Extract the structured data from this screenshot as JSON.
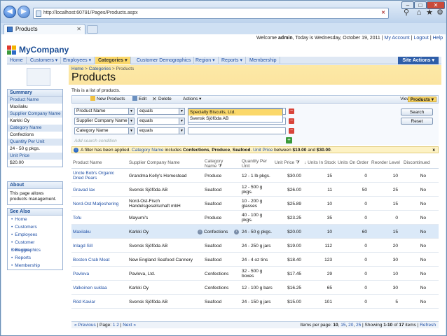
{
  "browser": {
    "url": "http://localhost:60791/Pages/Products.aspx",
    "tab_title": "Products"
  },
  "header": {
    "welcome_prefix": "Welcome",
    "user": "admin",
    "date_text": ", Today is Wednesday, October 19, 2011",
    "links": [
      "My Account",
      "Logout",
      "Help"
    ]
  },
  "brand": {
    "name": "MyCompany",
    "colors": [
      "#e03a2f",
      "#f4b400",
      "#3c9a3c",
      "#2d6bc7"
    ]
  },
  "menu": {
    "items": [
      "Home",
      "Customers",
      "Employees",
      "Categories",
      "Customer Demographics",
      "Region",
      "Reports",
      "Membership"
    ],
    "active": "Categories",
    "site_actions": "Site Actions"
  },
  "summary": {
    "title": "Summary",
    "fields": [
      {
        "label": "Product Name",
        "value": "Maxilaku"
      },
      {
        "label": "Supplier Company Name",
        "value": "Karkki Oy"
      },
      {
        "label": "Category Name",
        "value": "Confections"
      },
      {
        "label": "Quantity Per Unit",
        "value": "24 - 50 g pkgs."
      },
      {
        "label": "Unit Price",
        "value": "$20.00"
      }
    ]
  },
  "about": {
    "title": "About",
    "text": "This page allows products management."
  },
  "see_also": {
    "title": "See Also",
    "items": [
      "Home",
      "Customers",
      "Employees",
      "Customer Demographics",
      "Region",
      "Reports",
      "Membership"
    ]
  },
  "page": {
    "breadcrumb": [
      "Home",
      "Categories",
      "Products"
    ],
    "title": "Products",
    "description": "This is a list of products."
  },
  "toolbar": {
    "new": "New Products",
    "edit": "Edit",
    "delete": "Delete",
    "actions": "Actions",
    "view_label": "View:",
    "view_value": "Products"
  },
  "filters": {
    "rows": [
      {
        "field": "Product Name",
        "op": "equals",
        "value": ""
      },
      {
        "field": "Supplier Company Name",
        "op": "equals",
        "value": "s"
      },
      {
        "field": "Category Name",
        "op": "equals",
        "value": ""
      }
    ],
    "add_condition": "Add search condition",
    "suggestions": [
      "Specialty Biscuits, Ltd.",
      "Svensk Sjöföda AB"
    ],
    "search": "Search",
    "reset": "Reset"
  },
  "notice": {
    "t1": "A filter has been applied.",
    "t2": "Category Name",
    "t3": "includes",
    "t4": "Confections",
    "t5": ",",
    "t6": "Produce",
    "t7": ",",
    "t8": "Seafood",
    "t9": ".",
    "t10": "Unit Price",
    "t11": "between",
    "t12": "$10.00",
    "t13": "and",
    "t14": "$30.00",
    "t15": ".",
    "close": "x"
  },
  "grid": {
    "columns": [
      "Product Name",
      "Supplier Company Name",
      "Category Name",
      "Quantity Per Unit",
      "Unit Price",
      "Units In Stock",
      "Units On Order",
      "Reorder Level",
      "Discontinued"
    ],
    "rows": [
      [
        "Uncle Bob's Organic Dried Pears",
        "Grandma Kelly's Homestead",
        "Produce",
        "12 - 1 lb pkgs.",
        "$30.00",
        "15",
        "0",
        "10",
        "No"
      ],
      [
        "Gravad lax",
        "Svensk Sjöföda AB",
        "Seafood",
        "12 - 500 g pkgs.",
        "$26.00",
        "11",
        "50",
        "25",
        "No"
      ],
      [
        "Nord-Ost Matjeshering",
        "Nord-Ost-Fisch Handelsgesellschaft mbH",
        "Seafood",
        "10 - 200 g glasses",
        "$25.89",
        "10",
        "0",
        "15",
        "No"
      ],
      [
        "Tofu",
        "Mayumi's",
        "Produce",
        "40 - 100 g pkgs.",
        "$23.25",
        "35",
        "0",
        "0",
        "No"
      ],
      [
        "Maxilaku",
        "Karkki Oy",
        "Confections",
        "24 - 50 g pkgs.",
        "$20.00",
        "10",
        "60",
        "15",
        "No"
      ],
      [
        "Inlagd Sill",
        "Svensk Sjöföda AB",
        "Seafood",
        "24 - 250 g jars",
        "$19.00",
        "112",
        "0",
        "20",
        "No"
      ],
      [
        "Boston Crab Meat",
        "New England Seafood Cannery",
        "Seafood",
        "24 - 4 oz tins",
        "$18.40",
        "123",
        "0",
        "30",
        "No"
      ],
      [
        "Pavlova",
        "Pavlova, Ltd.",
        "Confections",
        "32 - 500 g boxes",
        "$17.45",
        "29",
        "0",
        "10",
        "No"
      ],
      [
        "Valkoinen suklaa",
        "Karkki Oy",
        "Confections",
        "12 - 100 g bars",
        "$16.25",
        "65",
        "0",
        "30",
        "No"
      ],
      [
        "Röd Kaviar",
        "Svensk Sjöföda AB",
        "Seafood",
        "24 - 150 g jars",
        "$15.00",
        "101",
        "0",
        "5",
        "No"
      ]
    ],
    "selected_row": 4
  },
  "pager": {
    "prev": "« Previous",
    "page_label": "Page:",
    "pages": [
      "1",
      "2"
    ],
    "next": "Next »",
    "items_label": "Items per page:",
    "sizes": [
      "10",
      "15",
      "20",
      "25"
    ],
    "showing": "Showing",
    "range": "1-10",
    "of": "of",
    "total": "17",
    "items": "items",
    "refresh": "Refresh"
  }
}
